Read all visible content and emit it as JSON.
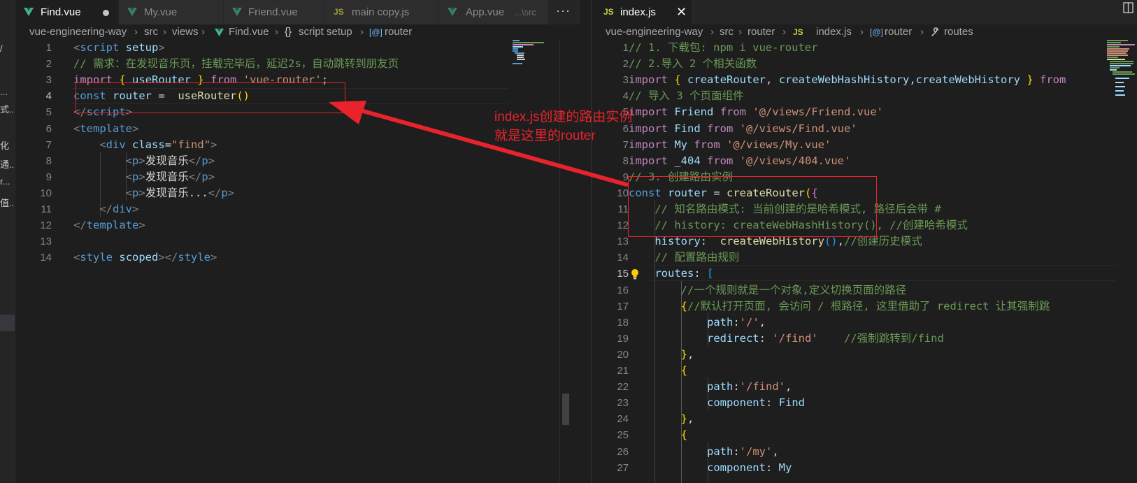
{
  "colors": {
    "annotation_red": "#e8232b",
    "editor_bg": "#1e1e1e",
    "vue_green": "#41b883",
    "js_yellow": "#cbcb41"
  },
  "sidebar_fragments": [
    "/",
    "...",
    "式...",
    "化",
    "通...",
    "r...",
    "值..."
  ],
  "left": {
    "tabs": [
      {
        "label": "Find.vue",
        "icon": "vue-icon",
        "modified": true
      },
      {
        "label": "My.vue",
        "icon": "vue-icon"
      },
      {
        "label": "Friend.vue",
        "icon": "vue-icon"
      },
      {
        "label": "main copy.js",
        "icon": "js-icon"
      },
      {
        "label": "App.vue",
        "hint": "...\\src",
        "icon": "vue-icon"
      }
    ],
    "more_label": "···",
    "js_badge": "JS",
    "breadcrumb": [
      "vue-engineering-way",
      "src",
      "views",
      "Find.vue",
      "script setup",
      "router"
    ],
    "crumb_prefix_braces": "{}",
    "crumb_sym": "[@]",
    "line_numbers": [
      "1",
      "2",
      "3",
      "4",
      "5",
      "6",
      "7",
      "8",
      "9",
      "10",
      "11",
      "12",
      "13",
      "14"
    ],
    "code_lines": [
      [
        [
          "c-br",
          "<"
        ],
        [
          "c-tag",
          "script"
        ],
        [
          "c-txt",
          " "
        ],
        [
          "c-attr",
          "setup"
        ],
        [
          "c-br",
          ">"
        ]
      ],
      [
        [
          "c-cmt",
          "// 需求：在发现音乐页，挂载完毕后，延迟2s，自动跳转到朋友页"
        ]
      ],
      [
        [
          "c-kw",
          "import"
        ],
        [
          "c-txt",
          " "
        ],
        [
          "c-y",
          "{"
        ],
        [
          "c-txt",
          " "
        ],
        [
          "c-var",
          "useRouter"
        ],
        [
          "c-txt",
          " "
        ],
        [
          "c-y",
          "}"
        ],
        [
          "c-txt",
          " "
        ],
        [
          "c-kw",
          "from"
        ],
        [
          "c-txt",
          " "
        ],
        [
          "c-str",
          "'vue-router'"
        ],
        [
          "c-txt",
          ";"
        ]
      ],
      [
        [
          "c-blue",
          "const"
        ],
        [
          "c-txt",
          " "
        ],
        [
          "c-var",
          "router"
        ],
        [
          "c-txt",
          " =  "
        ],
        [
          "c-fn",
          "useRouter"
        ],
        [
          "c-y",
          "()"
        ]
      ],
      [
        [
          "c-br",
          "</"
        ],
        [
          "c-tag",
          "script"
        ],
        [
          "c-br",
          ">"
        ]
      ],
      [
        [
          "c-br",
          "<"
        ],
        [
          "c-tag",
          "template"
        ],
        [
          "c-br",
          ">"
        ]
      ],
      [
        [
          "c-txt",
          "    "
        ],
        [
          "c-br",
          "<"
        ],
        [
          "c-tag",
          "div"
        ],
        [
          "c-txt",
          " "
        ],
        [
          "c-attr",
          "class"
        ],
        [
          "c-txt",
          "="
        ],
        [
          "c-str",
          "\"find\""
        ],
        [
          "c-br",
          ">"
        ]
      ],
      [
        [
          "c-txt",
          "        "
        ],
        [
          "c-br",
          "<"
        ],
        [
          "c-tag",
          "p"
        ],
        [
          "c-br",
          ">"
        ],
        [
          "c-txt",
          "发现音乐"
        ],
        [
          "c-br",
          "</"
        ],
        [
          "c-tag",
          "p"
        ],
        [
          "c-br",
          ">"
        ]
      ],
      [
        [
          "c-txt",
          "        "
        ],
        [
          "c-br",
          "<"
        ],
        [
          "c-tag",
          "p"
        ],
        [
          "c-br",
          ">"
        ],
        [
          "c-txt",
          "发现音乐"
        ],
        [
          "c-br",
          "</"
        ],
        [
          "c-tag",
          "p"
        ],
        [
          "c-br",
          ">"
        ]
      ],
      [
        [
          "c-txt",
          "        "
        ],
        [
          "c-br",
          "<"
        ],
        [
          "c-tag",
          "p"
        ],
        [
          "c-br",
          ">"
        ],
        [
          "c-txt",
          "发现音乐..."
        ],
        [
          "c-br",
          "</"
        ],
        [
          "c-tag",
          "p"
        ],
        [
          "c-br",
          ">"
        ]
      ],
      [
        [
          "c-txt",
          "    "
        ],
        [
          "c-br",
          "</"
        ],
        [
          "c-tag",
          "div"
        ],
        [
          "c-br",
          ">"
        ]
      ],
      [
        [
          "c-br",
          "</"
        ],
        [
          "c-tag",
          "template"
        ],
        [
          "c-br",
          ">"
        ]
      ],
      [],
      [
        [
          "c-br",
          "<"
        ],
        [
          "c-tag",
          "style"
        ],
        [
          "c-txt",
          " "
        ],
        [
          "c-attr",
          "scoped"
        ],
        [
          "c-br",
          "></"
        ],
        [
          "c-tag",
          "style"
        ],
        [
          "c-br",
          ">"
        ]
      ]
    ]
  },
  "right": {
    "tab": {
      "label": "index.js",
      "icon": "js-icon",
      "close": "✕"
    },
    "js_badge": "JS",
    "breadcrumb": [
      "vue-engineering-way",
      "src",
      "router",
      "index.js",
      "router",
      "routes"
    ],
    "crumb_sym": "[@]",
    "line_numbers": [
      "1",
      "2",
      "3",
      "4",
      "5",
      "6",
      "7",
      "8",
      "9",
      "10",
      "11",
      "12",
      "13",
      "14",
      "15",
      "16",
      "17",
      "18",
      "19",
      "20",
      "21",
      "22",
      "23",
      "24",
      "25",
      "26",
      "27"
    ],
    "code_lines": [
      [
        [
          "c-cmt",
          "// 1. 下载包: npm i vue-router"
        ]
      ],
      [
        [
          "c-cmt",
          "// 2.导入 2 个相关函数"
        ]
      ],
      [
        [
          "c-kw",
          "import"
        ],
        [
          "c-txt",
          " "
        ],
        [
          "c-y",
          "{"
        ],
        [
          "c-txt",
          " "
        ],
        [
          "c-var",
          "createRouter"
        ],
        [
          "c-txt",
          ", "
        ],
        [
          "c-var",
          "createWebHashHistory"
        ],
        [
          "c-txt",
          ","
        ],
        [
          "c-var",
          "createWebHistory"
        ],
        [
          "c-txt",
          " "
        ],
        [
          "c-y",
          "}"
        ],
        [
          "c-txt",
          " "
        ],
        [
          "c-kw",
          "from"
        ]
      ],
      [
        [
          "c-cmt",
          "// 导入 3 个页面组件"
        ]
      ],
      [
        [
          "c-kw",
          "import"
        ],
        [
          "c-txt",
          " "
        ],
        [
          "c-var",
          "Friend"
        ],
        [
          "c-txt",
          " "
        ],
        [
          "c-kw",
          "from"
        ],
        [
          "c-txt",
          " "
        ],
        [
          "c-str",
          "'@/views/Friend.vue'"
        ]
      ],
      [
        [
          "c-kw",
          "import"
        ],
        [
          "c-txt",
          " "
        ],
        [
          "c-var",
          "Find"
        ],
        [
          "c-txt",
          " "
        ],
        [
          "c-kw",
          "from"
        ],
        [
          "c-txt",
          " "
        ],
        [
          "c-str",
          "'@/views/Find.vue'"
        ]
      ],
      [
        [
          "c-kw",
          "import"
        ],
        [
          "c-txt",
          " "
        ],
        [
          "c-var",
          "My"
        ],
        [
          "c-txt",
          " "
        ],
        [
          "c-kw",
          "from"
        ],
        [
          "c-txt",
          " "
        ],
        [
          "c-str",
          "'@/views/My.vue'"
        ]
      ],
      [
        [
          "c-kw",
          "import"
        ],
        [
          "c-txt",
          " "
        ],
        [
          "c-var",
          "_404"
        ],
        [
          "c-txt",
          " "
        ],
        [
          "c-kw",
          "from"
        ],
        [
          "c-txt",
          " "
        ],
        [
          "c-str",
          "'@/views/404.vue'"
        ]
      ],
      [
        [
          "c-cmt",
          "// 3. 创建路由实例"
        ]
      ],
      [
        [
          "c-blue",
          "const"
        ],
        [
          "c-txt",
          " "
        ],
        [
          "c-var",
          "router"
        ],
        [
          "c-txt",
          " = "
        ],
        [
          "c-fn",
          "createRouter"
        ],
        [
          "c-y",
          "("
        ],
        [
          "c-p",
          "{"
        ]
      ],
      [
        [
          "c-txt",
          "    "
        ],
        [
          "c-cmt",
          "// 知名路由模式: 当前创建的是哈希模式, 路径后会带 #"
        ]
      ],
      [
        [
          "c-txt",
          "    "
        ],
        [
          "c-cmt",
          "// history: createWebHashHistory(), //创建哈希模式"
        ]
      ],
      [
        [
          "c-txt",
          "    "
        ],
        [
          "c-var",
          "history"
        ],
        [
          "c-txt",
          ":  "
        ],
        [
          "c-fn",
          "createWebHistory"
        ],
        [
          "c-l",
          "()"
        ],
        [
          "c-txt",
          ","
        ],
        [
          "c-cmt",
          "//创建历史模式"
        ]
      ],
      [
        [
          "c-txt",
          "    "
        ],
        [
          "c-cmt",
          "// 配置路由规则"
        ]
      ],
      [
        [
          "c-txt",
          "    "
        ],
        [
          "c-var",
          "routes"
        ],
        [
          "c-txt",
          ": "
        ],
        [
          "c-l",
          "["
        ]
      ],
      [
        [
          "c-txt",
          "        "
        ],
        [
          "c-cmt",
          "//一个规则就是一个对象,定义切换页面的路径"
        ]
      ],
      [
        [
          "c-txt",
          "        "
        ],
        [
          "c-y",
          "{"
        ],
        [
          "c-cmt",
          "//默认打开页面, 会访问 / 根路径, 这里借助了 redirect 让其强制跳"
        ]
      ],
      [
        [
          "c-txt",
          "            "
        ],
        [
          "c-var",
          "path"
        ],
        [
          "c-txt",
          ":"
        ],
        [
          "c-str",
          "'/'"
        ],
        [
          "c-txt",
          ","
        ]
      ],
      [
        [
          "c-txt",
          "            "
        ],
        [
          "c-var",
          "redirect"
        ],
        [
          "c-txt",
          ": "
        ],
        [
          "c-str",
          "'/find'"
        ],
        [
          "c-txt",
          "    "
        ],
        [
          "c-cmt",
          "//强制跳转到/find"
        ]
      ],
      [
        [
          "c-txt",
          "        "
        ],
        [
          "c-y",
          "}"
        ],
        [
          "c-txt",
          ","
        ]
      ],
      [
        [
          "c-txt",
          "        "
        ],
        [
          "c-y",
          "{"
        ]
      ],
      [
        [
          "c-txt",
          "            "
        ],
        [
          "c-var",
          "path"
        ],
        [
          "c-txt",
          ":"
        ],
        [
          "c-str",
          "'/find'"
        ],
        [
          "c-txt",
          ","
        ]
      ],
      [
        [
          "c-txt",
          "            "
        ],
        [
          "c-var",
          "component"
        ],
        [
          "c-txt",
          ": "
        ],
        [
          "c-var",
          "Find"
        ]
      ],
      [
        [
          "c-txt",
          "        "
        ],
        [
          "c-y",
          "}"
        ],
        [
          "c-txt",
          ","
        ]
      ],
      [
        [
          "c-txt",
          "        "
        ],
        [
          "c-y",
          "{"
        ]
      ],
      [
        [
          "c-txt",
          "            "
        ],
        [
          "c-var",
          "path"
        ],
        [
          "c-txt",
          ":"
        ],
        [
          "c-str",
          "'/my'"
        ],
        [
          "c-txt",
          ","
        ]
      ],
      [
        [
          "c-txt",
          "            "
        ],
        [
          "c-var",
          "component"
        ],
        [
          "c-txt",
          ": "
        ],
        [
          "c-var",
          "My"
        ]
      ]
    ]
  },
  "annotation": {
    "line1": "index.js创建的路由实例",
    "line2": "就是这里的router"
  }
}
